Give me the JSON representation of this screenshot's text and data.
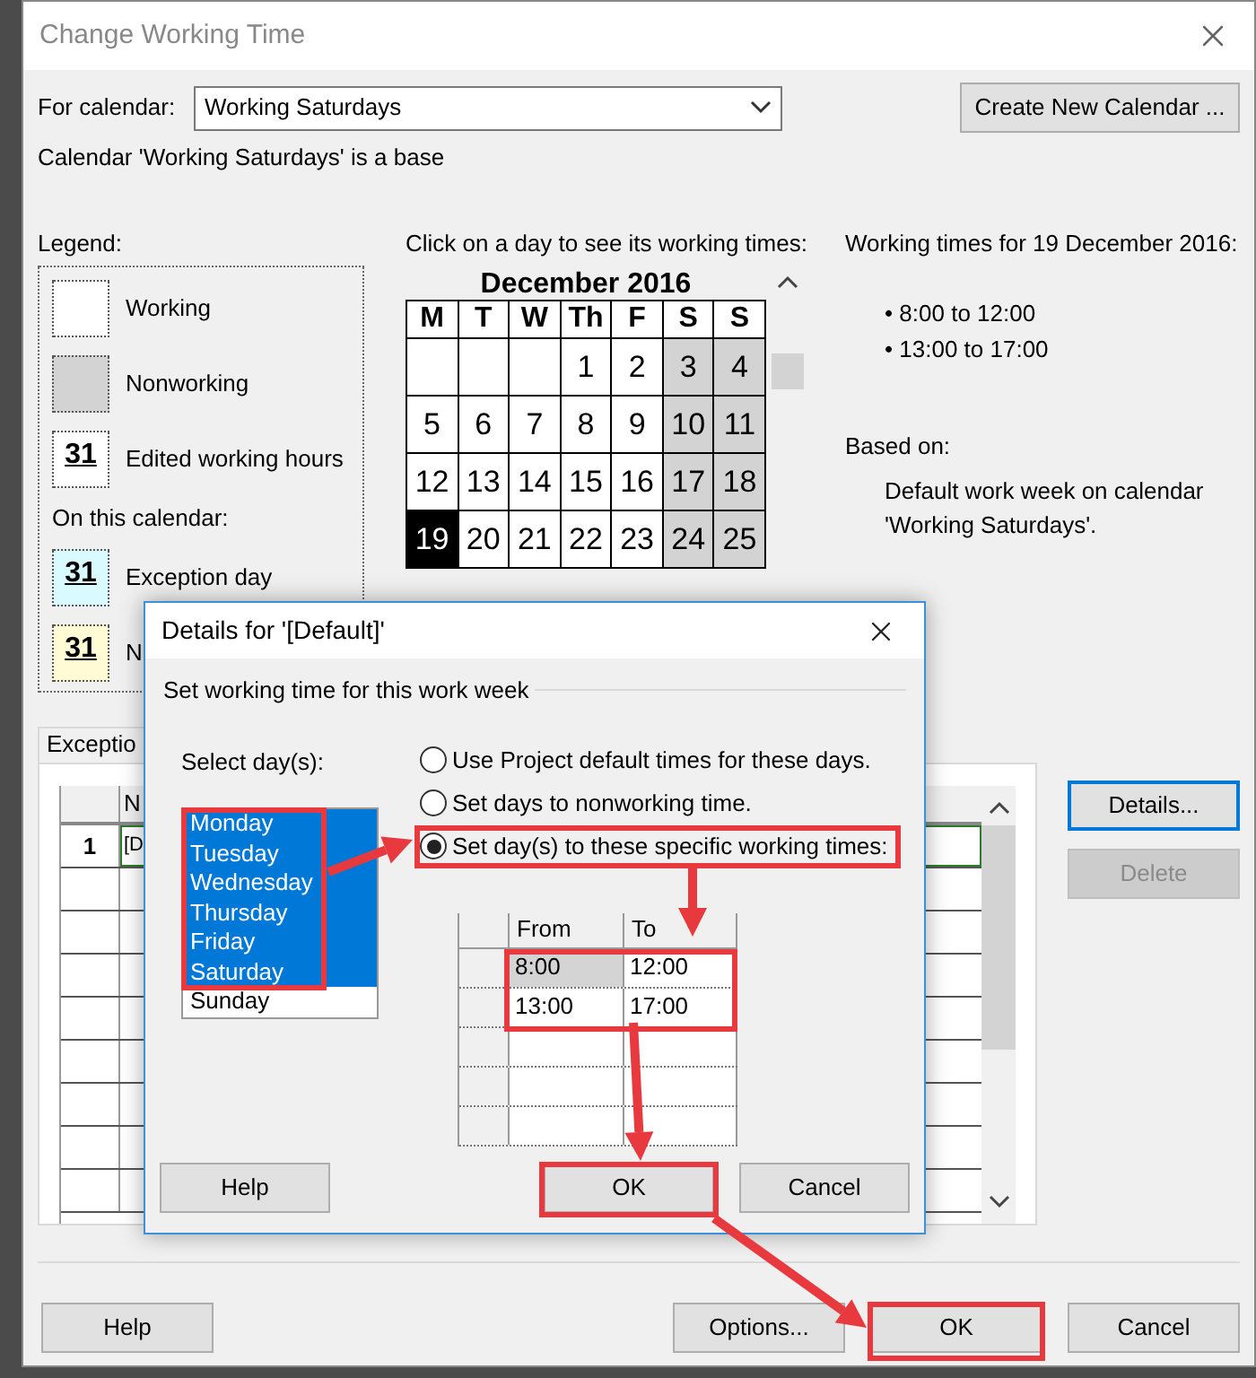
{
  "window": {
    "title": "Change Working Time"
  },
  "calendar_field": {
    "label": "For calendar:",
    "value": "Working Saturdays"
  },
  "create_button": "Create New Calendar ...",
  "base_note": "Calendar 'Working Saturdays' is a base",
  "legend": {
    "title": "Legend:",
    "items": [
      {
        "kind": "working",
        "label": "Working"
      },
      {
        "kind": "nonworking",
        "label": "Nonworking"
      },
      {
        "kind": "edited",
        "sample": "31",
        "label": "Edited working hours"
      }
    ],
    "section": "On this calendar:",
    "calendar_items": [
      {
        "kind": "exception",
        "sample": "31",
        "label": "Exception day"
      },
      {
        "kind": "nondefault",
        "sample": "31",
        "label": "N"
      }
    ]
  },
  "calendar": {
    "hint": "Click on a day to see its working times:",
    "month": "December 2016",
    "weekdays": [
      "M",
      "T",
      "W",
      "Th",
      "F",
      "S",
      "S"
    ],
    "weeks": [
      [
        {
          "kind": "blank"
        },
        {
          "kind": "blank"
        },
        {
          "kind": "blank"
        },
        {
          "kind": "day",
          "text": "1",
          "nonworking": false,
          "selected": false
        },
        {
          "kind": "day",
          "text": "2",
          "nonworking": false,
          "selected": false
        },
        {
          "kind": "day",
          "text": "3",
          "nonworking": true,
          "selected": false
        },
        {
          "kind": "day",
          "text": "4",
          "nonworking": true,
          "selected": false
        }
      ],
      [
        {
          "kind": "day",
          "text": "5",
          "nonworking": false,
          "selected": false
        },
        {
          "kind": "day",
          "text": "6",
          "nonworking": false,
          "selected": false
        },
        {
          "kind": "day",
          "text": "7",
          "nonworking": false,
          "selected": false
        },
        {
          "kind": "day",
          "text": "8",
          "nonworking": false,
          "selected": false
        },
        {
          "kind": "day",
          "text": "9",
          "nonworking": false,
          "selected": false
        },
        {
          "kind": "day",
          "text": "10",
          "nonworking": true,
          "selected": false
        },
        {
          "kind": "day",
          "text": "11",
          "nonworking": true,
          "selected": false
        }
      ],
      [
        {
          "kind": "day",
          "text": "12",
          "nonworking": false,
          "selected": false
        },
        {
          "kind": "day",
          "text": "13",
          "nonworking": false,
          "selected": false
        },
        {
          "kind": "day",
          "text": "14",
          "nonworking": false,
          "selected": false
        },
        {
          "kind": "day",
          "text": "15",
          "nonworking": false,
          "selected": false
        },
        {
          "kind": "day",
          "text": "16",
          "nonworking": false,
          "selected": false
        },
        {
          "kind": "day",
          "text": "17",
          "nonworking": true,
          "selected": false
        },
        {
          "kind": "day",
          "text": "18",
          "nonworking": true,
          "selected": false
        }
      ],
      [
        {
          "kind": "day",
          "text": "19",
          "nonworking": false,
          "selected": true
        },
        {
          "kind": "day",
          "text": "20",
          "nonworking": false,
          "selected": false
        },
        {
          "kind": "day",
          "text": "21",
          "nonworking": false,
          "selected": false
        },
        {
          "kind": "day",
          "text": "22",
          "nonworking": false,
          "selected": false
        },
        {
          "kind": "day",
          "text": "23",
          "nonworking": false,
          "selected": false
        },
        {
          "kind": "day",
          "text": "24",
          "nonworking": true,
          "selected": false
        },
        {
          "kind": "day",
          "text": "25",
          "nonworking": true,
          "selected": false
        }
      ]
    ]
  },
  "working_times": {
    "title": "Working times for 19 December 2016:",
    "items": [
      "• 8:00 to 12:00",
      "• 13:00 to 17:00"
    ],
    "based_on_label": "Based on:",
    "based_on": "Default work week on calendar 'Working Saturdays'."
  },
  "exceptions": {
    "tab": "Exceptio",
    "header": "N",
    "rows": [
      {
        "number": "1",
        "name": "[D"
      }
    ]
  },
  "side_buttons": [
    {
      "label": "Details...",
      "disabled": false
    },
    {
      "label": "Delete",
      "disabled": true
    }
  ],
  "footer_buttons": [
    {
      "label": "Help"
    },
    {
      "label": "Options..."
    },
    {
      "label": "OK"
    },
    {
      "label": "Cancel"
    }
  ],
  "details_dialog": {
    "title": "Details for '[Default]'",
    "group": "Set working time for this work week",
    "days_label": "Select day(s):",
    "days": [
      {
        "label": "Monday",
        "selected": true
      },
      {
        "label": "Tuesday",
        "selected": true
      },
      {
        "label": "Wednesday",
        "selected": true
      },
      {
        "label": "Thursday",
        "selected": true
      },
      {
        "label": "Friday",
        "selected": true
      },
      {
        "label": "Saturday",
        "selected": true
      },
      {
        "label": "Sunday",
        "selected": false
      }
    ],
    "options": [
      {
        "label": "Use Project default times for these days.",
        "selected": false
      },
      {
        "label": "Set days to nonworking time.",
        "selected": false
      },
      {
        "label": "Set day(s) to these specific working times:",
        "selected": true
      }
    ],
    "columns": [
      "From",
      "To"
    ],
    "times": [
      [
        "8:00",
        "12:00"
      ],
      [
        "13:00",
        "17:00"
      ]
    ],
    "buttons": [
      {
        "label": "Help"
      },
      {
        "label": "OK"
      },
      {
        "label": "Cancel"
      }
    ]
  }
}
